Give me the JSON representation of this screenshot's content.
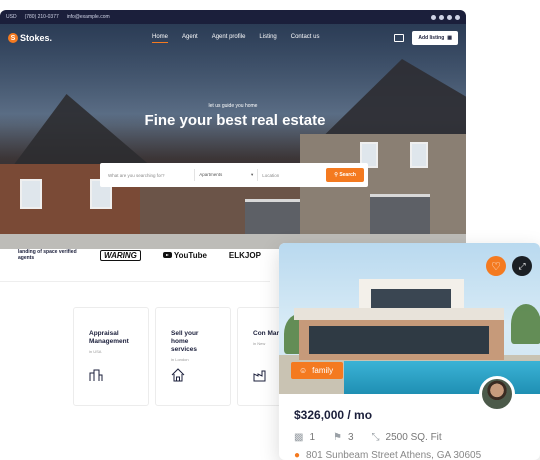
{
  "topbar": {
    "currency": "USD",
    "phone": "(780) 210-0377",
    "email": "info@example.com"
  },
  "nav": {
    "logo_letter": "S",
    "logo": "Stokes.",
    "items": [
      {
        "label": "Home",
        "active": true
      },
      {
        "label": "Agent",
        "active": false
      },
      {
        "label": "Agent profile",
        "active": false
      },
      {
        "label": "Listing",
        "active": false
      },
      {
        "label": "Contact us",
        "active": false
      }
    ],
    "add_listing": "Add listing"
  },
  "hero": {
    "subtitle": "let us guide you home",
    "title": "Fine your best real estate",
    "search": {
      "placeholder": "What are you searching for?",
      "type_value": "Apartments",
      "location_placeholder": "Location",
      "button": "Search"
    }
  },
  "brands": {
    "tagline": "landing of space verified agents",
    "logos": [
      "WARING",
      "YouTube",
      "ELKJOP"
    ]
  },
  "services": [
    {
      "title": "Appraisal Management",
      "subtitle": "in USA",
      "icon": "building-icon"
    },
    {
      "title": "Sell your home services",
      "subtitle": "in London",
      "icon": "house-icon"
    },
    {
      "title": "Con Man",
      "subtitle": "in New",
      "icon": "factory-icon"
    }
  ],
  "card": {
    "badge": "family",
    "price": "$326,000 / mo",
    "beds": "1",
    "baths": "3",
    "area": "2500 SQ. Fit",
    "address": "801 Sunbeam Street Athens, GA 30605"
  },
  "colors": {
    "accent": "#f47a20",
    "dark": "#1b1f3b"
  }
}
